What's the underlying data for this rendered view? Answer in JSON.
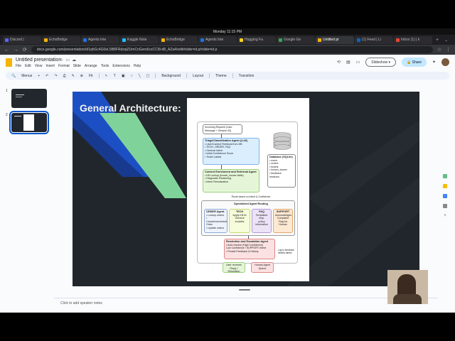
{
  "os": {
    "clock": "Monday 11:15 PM"
  },
  "tabs": [
    {
      "label": "Discord |",
      "color": "#5865f2"
    },
    {
      "label": "EchoBridge",
      "color": "#f4b400"
    },
    {
      "label": "Agents Inte",
      "color": "#1a73e8"
    },
    {
      "label": "Kaggle Note",
      "color": "#20beff"
    },
    {
      "label": "EchoBridge",
      "color": "#f4b400"
    },
    {
      "label": "Agents Inte",
      "color": "#1a73e8"
    },
    {
      "label": "Hugging Fa",
      "color": "#ffd21e"
    },
    {
      "label": "Google Ge",
      "color": "#34a853"
    },
    {
      "label": "Untitled pr",
      "color": "#f4b400",
      "active": true
    },
    {
      "label": "(1) Feed | Li",
      "color": "#0a66c2"
    },
    {
      "label": "Inbox (1) | k",
      "color": "#ea4335"
    }
  ],
  "address": {
    "url": "docs.google.com/presentation/d/1qhGc4G0eL5B8FRdzqiZUmCnGerx6cxCCI8-d8_AZa4/edit#slide=id.p#slide=id.p"
  },
  "doc": {
    "title": "Untitled presentation",
    "menus": [
      "File",
      "Edit",
      "View",
      "Insert",
      "Format",
      "Slide",
      "Arrange",
      "Tools",
      "Extensions",
      "Help"
    ],
    "slideshow_label": "Slideshow",
    "share_label": "Share"
  },
  "toolbar": {
    "menus_label": "Menus",
    "zoom_label": "Fit",
    "background_label": "Background",
    "layout_label": "Layout",
    "theme_label": "Theme",
    "transition_label": "Transition"
  },
  "filmstrip": {
    "slide1_num": "1",
    "slide2_num": "2"
  },
  "slide": {
    "title": "General Architecture:",
    "diagram": {
      "incoming": "Incoming Request (User Message + Session ID)",
      "triage_title": "Triage/Classification Agent (LLM)",
      "triage_items": [
        "• User/Context Retrieval from DB",
        "• TECH, ORDER, FAQ",
        "• General Intent",
        "• Initial Confidence Score",
        "• Ticket Labels"
      ],
      "db_title": "Database (SQLite)",
      "db_items": [
        "• users",
        "• orders",
        "• tickets",
        "• known_issues",
        "• feedback",
        "  sessions"
      ],
      "context_title": "Context Enrichment and Retrieval Agent",
      "context_items": [
        "• KB Lookup (known_issues table)",
        "• Diagnostic Reasoning",
        "• Intent Reevaluation"
      ],
      "route_label": "Route based on Intent & Confidence",
      "routing_title": "Specialized Agent Routing",
      "order_title": "ORDER Agent",
      "order_items": [
        "• Lookup orders",
        "• Cancel/reschedule Order",
        "• Update orders"
      ],
      "tech_title": "TECH",
      "tech_items": [
        "Apply KB fix",
        "General troubles"
      ],
      "faq_title": "FAQ",
      "faq_items": [
        "Templated resp.",
        "policy information"
      ],
      "support_title": "SUPPORT",
      "support_items": [
        "Acknowledges Complaint",
        "Flag for Human"
      ],
      "resolution_title": "Resolution and Escalation Agent",
      "resolution_items": [
        "• Auto resolve (High Confidence)",
        "Low Confidence / SUPPORT Intent",
        "• Persist Feedback & History"
      ],
      "log_label": "Log to feedback /tickets tables",
      "user_reply": "User receives Reply / Resolution",
      "human_agent": "Human Agent Queue"
    }
  },
  "notes": {
    "placeholder": "Click to add speaker notes"
  },
  "colors": {
    "accent": "#0b57d0",
    "share_bg": "#c2e7ff",
    "slide_bg": "#21262c",
    "stripe_green": "#7fd39a",
    "stripe_blue": "#1d4fc4"
  }
}
